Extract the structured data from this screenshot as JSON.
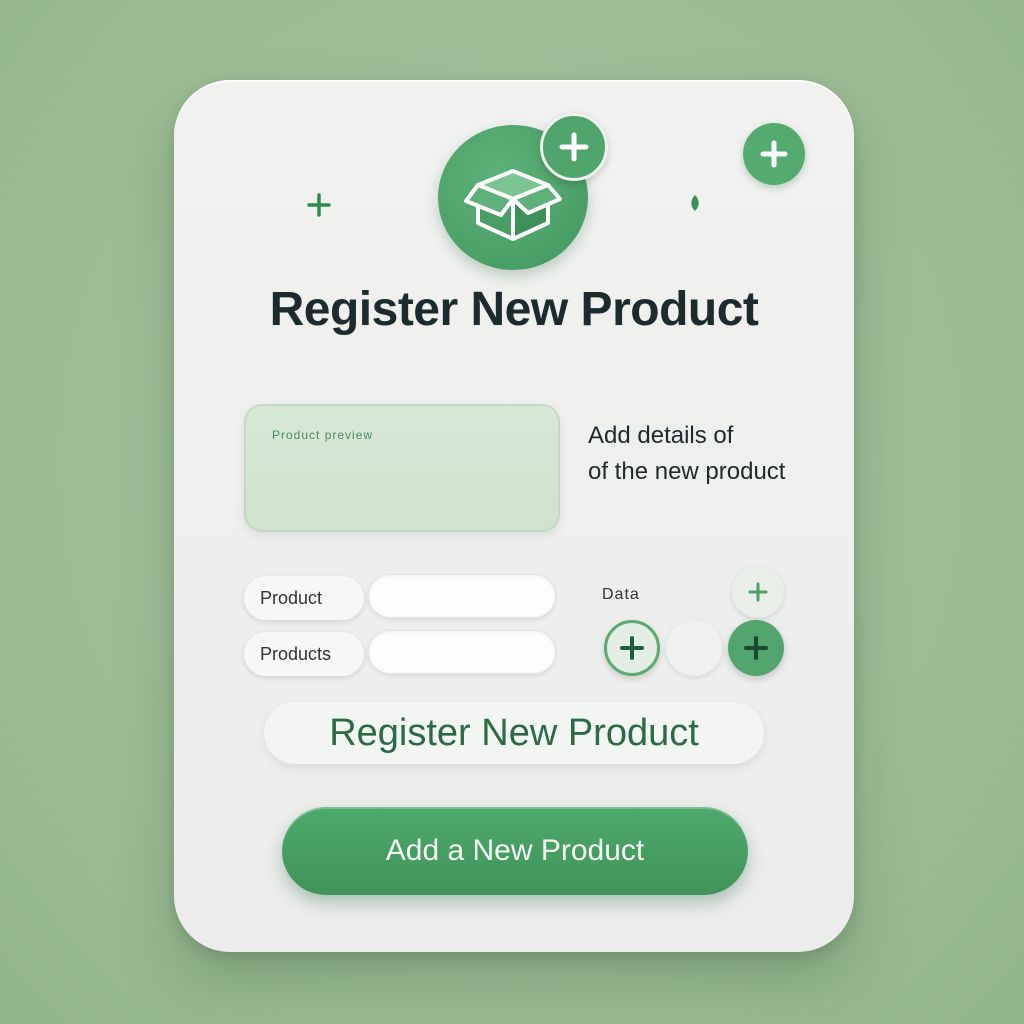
{
  "header": {
    "title": "Register New Product",
    "hero_icon": "box-icon"
  },
  "preview": {
    "label": "Product preview"
  },
  "description": {
    "line1": "Add details of",
    "line2": "of the new product"
  },
  "form": {
    "fields": [
      {
        "label": "Product",
        "value": ""
      },
      {
        "label": "Products",
        "value": ""
      }
    ],
    "data_label": "Data"
  },
  "actions": {
    "register_link_label": "Register New Product",
    "primary_label": "Add a New Product"
  },
  "colors": {
    "background": "#9dbd97",
    "accent": "#4fa56c",
    "accent_dark": "#2b6b44",
    "card": "#eeefed",
    "title": "#1d2b2e"
  }
}
